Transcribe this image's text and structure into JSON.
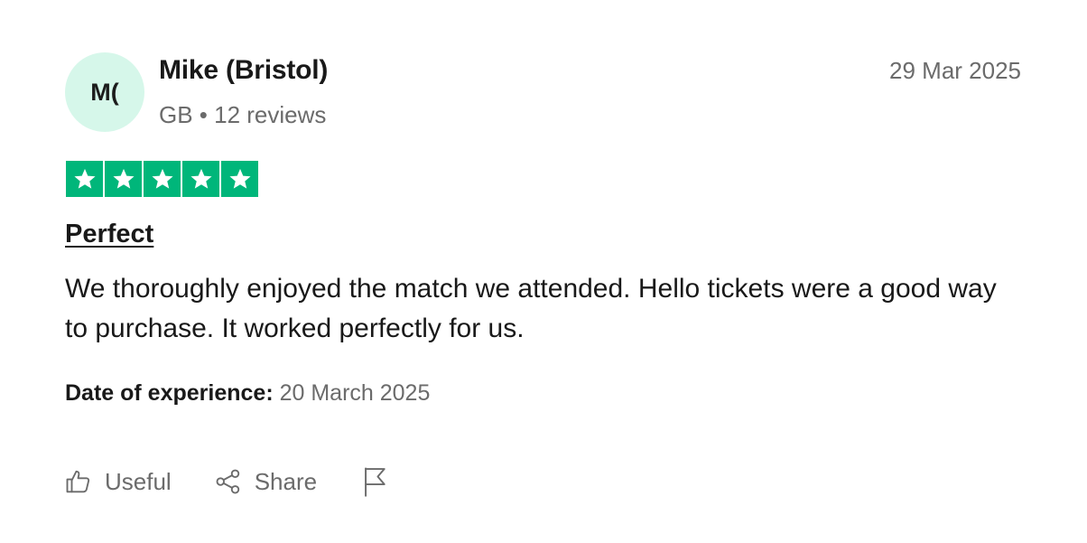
{
  "reviewer": {
    "initials": "M(",
    "name": "Mike (Bristol)",
    "meta": "GB • 12 reviews"
  },
  "review": {
    "date": "29 Mar 2025",
    "rating": 5,
    "star_color": "#00b67a",
    "title": "Perfect",
    "body": "We thoroughly enjoyed the match we attended. Hello tickets were a good way to purchase. It worked perfectly for us.",
    "experience_label": "Date of experience:",
    "experience_value": "20 March 2025"
  },
  "actions": {
    "useful_label": "Useful",
    "share_label": "Share",
    "useful_icon": "thumbs-up-icon",
    "share_icon": "share-icon",
    "report_icon": "flag-icon"
  }
}
